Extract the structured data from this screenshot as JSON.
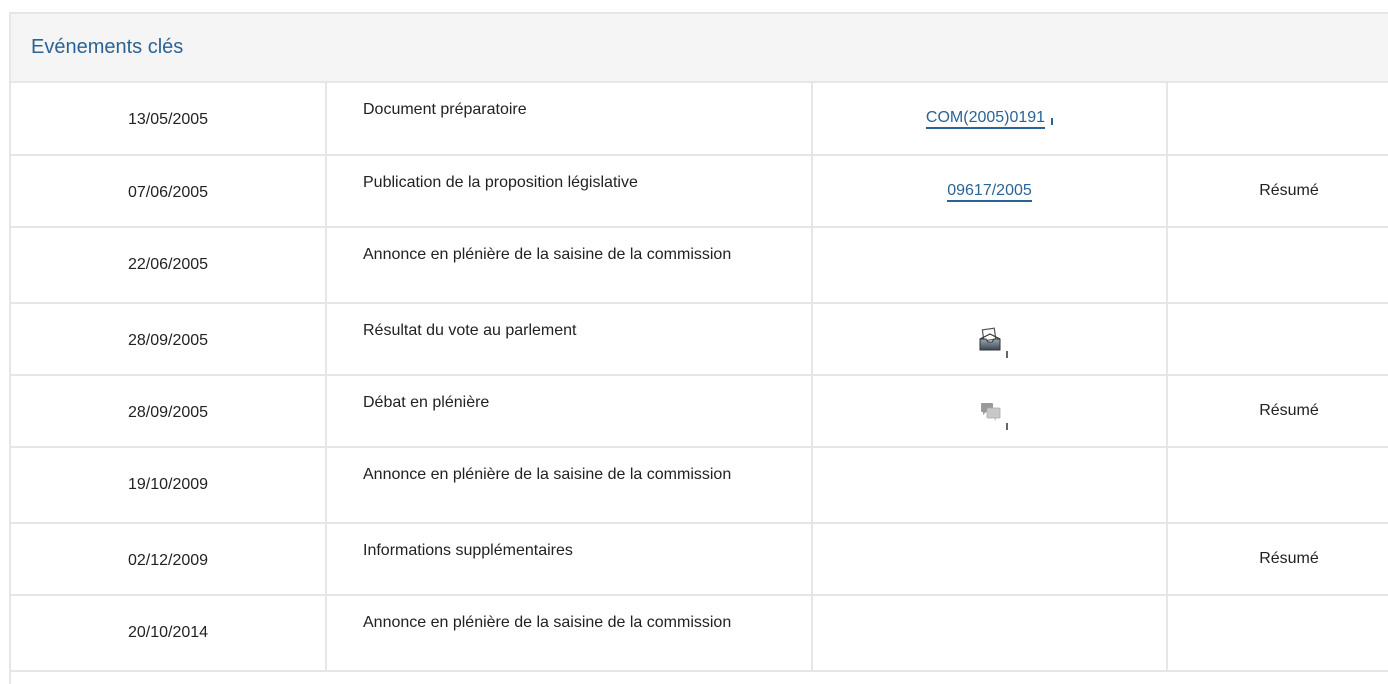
{
  "panel": {
    "title": "Evénements clés"
  },
  "events": [
    {
      "date": "13/05/2005",
      "event": "Document préparatoire",
      "doc": {
        "kind": "link",
        "text": "COM(2005)0191"
      },
      "summary": ""
    },
    {
      "date": "07/06/2005",
      "event": "Publication de la proposition législative",
      "doc": {
        "kind": "link",
        "text": "09617/2005"
      },
      "summary": "Résumé"
    },
    {
      "date": "22/06/2005",
      "event": "Annonce en plénière de la saisine de la commission",
      "doc": {
        "kind": "none",
        "text": ""
      },
      "summary": ""
    },
    {
      "date": "28/09/2005",
      "event": "Résultat du vote au parlement",
      "doc": {
        "kind": "icon",
        "icon": "vote-ballot-icon"
      },
      "summary": ""
    },
    {
      "date": "28/09/2005",
      "event": "Débat en plénière",
      "doc": {
        "kind": "icon",
        "icon": "debate-chat-icon"
      },
      "summary": "Résumé"
    },
    {
      "date": "19/10/2009",
      "event": "Annonce en plénière de la saisine de la commission",
      "doc": {
        "kind": "none",
        "text": ""
      },
      "summary": ""
    },
    {
      "date": "02/12/2009",
      "event": "Informations supplémentaires",
      "doc": {
        "kind": "none",
        "text": ""
      },
      "summary": "Résumé"
    },
    {
      "date": "20/10/2014",
      "event": "Annonce en plénière de la saisine de la commission",
      "doc": {
        "kind": "none",
        "text": ""
      },
      "summary": ""
    }
  ],
  "colors": {
    "link": "#2a6496",
    "border": "#e6e6e6",
    "header_bg": "#f5f5f5",
    "text": "#222222"
  }
}
